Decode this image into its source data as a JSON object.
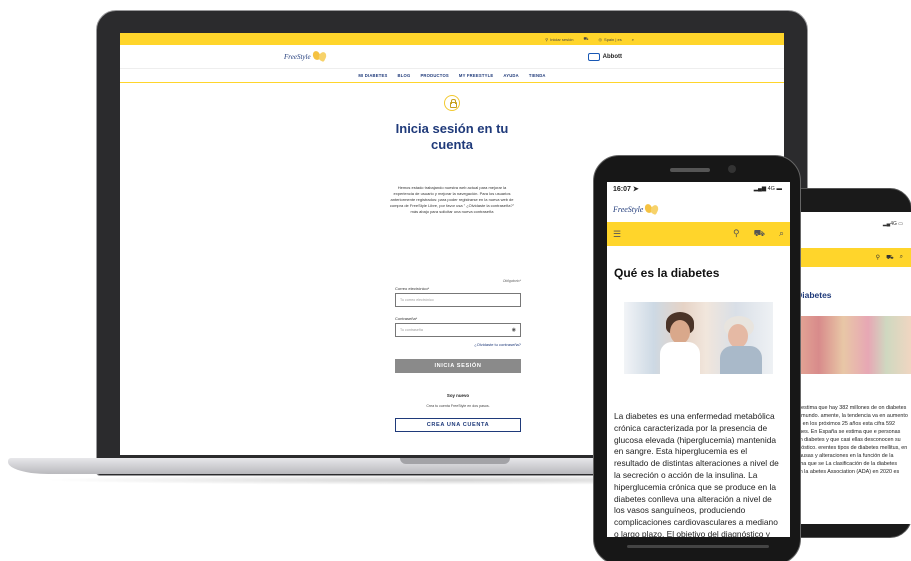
{
  "laptop": {
    "topbar": {
      "login": "Iniciar sesión",
      "language": "Spain | es"
    },
    "brand": {
      "logo": "FreeStyle",
      "partner": "Abbott"
    },
    "nav": [
      "MI DIABETES",
      "BLOG",
      "PRODUCTOS",
      "MY FREESTYLE",
      "AYUDA",
      "TIENDA"
    ],
    "title_line1": "Inicia sesión en tu",
    "title_line2": "cuenta",
    "intro": "Hemos estado trabajando nuestra web actual para mejorar la experiencia de usuario y mejorar la navegación. Para los usuarios anteriormente registrados: para poder registrarse en la nueva web de compra de FreeStyle Libre, por favor usa \" ¿Olvidaste la contraseña?\" más abajo para solicitar una nueva contraseña",
    "form": {
      "required_note": "Obligatorio*",
      "email_label": "Correo electrónico*",
      "email_placeholder": "Tu correo electrónico",
      "password_label": "Contraseña*",
      "password_placeholder": "Tu contraseña",
      "forgot": "¿Olvidaste tu contraseña?",
      "submit": "INICIA SESIÓN",
      "new_user_heading": "Soy nuevo",
      "new_user_text": "Crea tu cuenta FreeStyle en dos pasos.",
      "create_account": "CREA UNA CUENTA"
    }
  },
  "phone_front": {
    "time": "16:07",
    "signal": "4G",
    "logo": "FreeStyle",
    "title": "Qué es la diabetes",
    "body": "La diabetes es una enfermedad metabólica crónica caracterizada por la presencia de glucosa elevada (hiperglucemia) mantenida en sangre. Esta hiperglucemia es el resultado de distintas alteraciones a nivel de la secreción o acción de la insulina. La hiperglucemia crónica que se produce en la diabetes conlleva una alteración a nivel de los vasos sanguíneos, produciendo complicaciones cardiovasculares a mediano o largo plazo. El objetivo del diagnóstico y tratamiento de la diabetes es intentar prevenir el desarrollo de dichas complicaciones."
  },
  "phone_back": {
    "signal": "4G",
    "title": "e Diabetes",
    "body": "e, se estima que hay 382 millones de on diabetes en el mundo. amente, la tendencia va en aumento y que en los próximos 25 años esta cifra 592 millones. En España se estima que e personas tienen diabetes y que casi ellas desconocen su diagnóstico. erentes tipos de diabetes mellitus, en las causas y alteraciones en la función de la insulina que se La clasificación de la diabetes según la abetes Association (ADA) en 2020 es"
  },
  "colors": {
    "accent": "#ffd52b",
    "brand": "#1f3a7a"
  }
}
